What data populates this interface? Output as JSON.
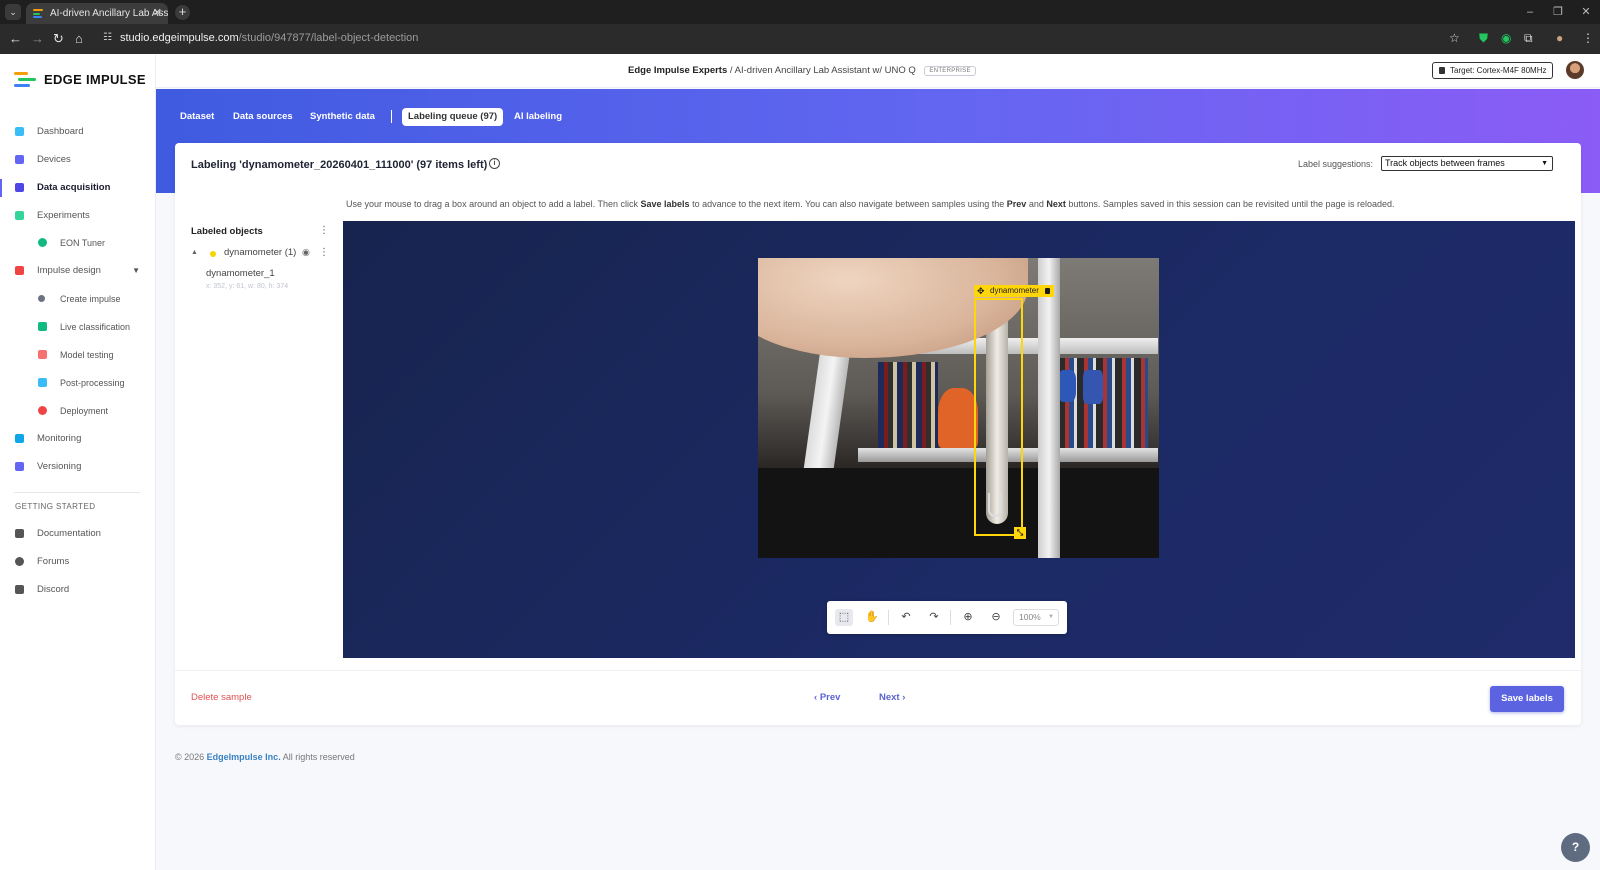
{
  "browser": {
    "tab_title": "AI-driven Ancillary Lab Assistan",
    "tab_close": "✕",
    "new_tab": "+",
    "url_host": "studio.edgeimpulse.com",
    "url_path": "/studio/947877/label-object-detection"
  },
  "sidebar": {
    "logo_text": "EDGE IMPULSE",
    "items": [
      {
        "label": "Dashboard",
        "color": "#38bdf8"
      },
      {
        "label": "Devices",
        "color": "#6366f1"
      },
      {
        "label": "Data acquisition",
        "color": "#4f46e5"
      },
      {
        "label": "Experiments",
        "color": "#34d399"
      },
      {
        "label": "EON Tuner",
        "color": "#10b981"
      },
      {
        "label": "Impulse design",
        "color": "#ef4444"
      },
      {
        "label": "Create impulse",
        "color": "#6b7280"
      },
      {
        "label": "Live classification",
        "color": "#10b981"
      },
      {
        "label": "Model testing",
        "color": "#f87171"
      },
      {
        "label": "Post-processing",
        "color": "#38bdf8"
      },
      {
        "label": "Deployment",
        "color": "#ef4444"
      },
      {
        "label": "Monitoring",
        "color": "#0ea5e9"
      },
      {
        "label": "Versioning",
        "color": "#6366f1"
      }
    ],
    "section_title": "GETTING STARTED",
    "getting_started": [
      {
        "label": "Documentation"
      },
      {
        "label": "Forums"
      },
      {
        "label": "Discord"
      }
    ]
  },
  "header": {
    "org": "Edge Impulse Experts",
    "separator": "/",
    "project": "AI-driven Ancillary Lab Assistant w/ UNO Q",
    "badge": "ENTERPRISE",
    "target": "Target: Cortex-M4F 80MHz"
  },
  "subtabs": [
    {
      "label": "Dataset"
    },
    {
      "label": "Data sources"
    },
    {
      "label": "Synthetic data"
    },
    {
      "label": "Labeling queue (97)"
    },
    {
      "label": "AI labeling"
    }
  ],
  "card": {
    "title": "Labeling 'dynamometer_20260401_111000' (97 items left)",
    "suggestions_label": "Label suggestions:",
    "suggestions_value": "Track objects between frames",
    "hint_1": "Use your mouse to drag a box around an object to add a label. Then click ",
    "hint_save": "Save labels",
    "hint_2": " to advance to the next item. You can also navigate between samples using the ",
    "hint_prev": "Prev",
    "hint_3": " and ",
    "hint_next": "Next",
    "hint_4": " buttons. Samples saved in this session can be revisited until the page is reloaded."
  },
  "labeled_objects": {
    "title": "Labeled objects",
    "group_name": "dynamometer (1)",
    "item_name": "dynamometer_1",
    "item_coords": "x: 352, y: 61, w: 80, h: 374"
  },
  "canvas": {
    "box_label": "dynamometer",
    "zoom": "100%"
  },
  "actions": {
    "delete": "Delete sample",
    "prev": "Prev",
    "next": "Next",
    "save": "Save labels"
  },
  "footer": {
    "prefix": "© 2026",
    "company": "EdgeImpulse Inc.",
    "suffix": "All rights reserved"
  },
  "colors": {
    "accent": "#5b63e0",
    "box": "#ffd60a",
    "danger": "#e05252"
  }
}
